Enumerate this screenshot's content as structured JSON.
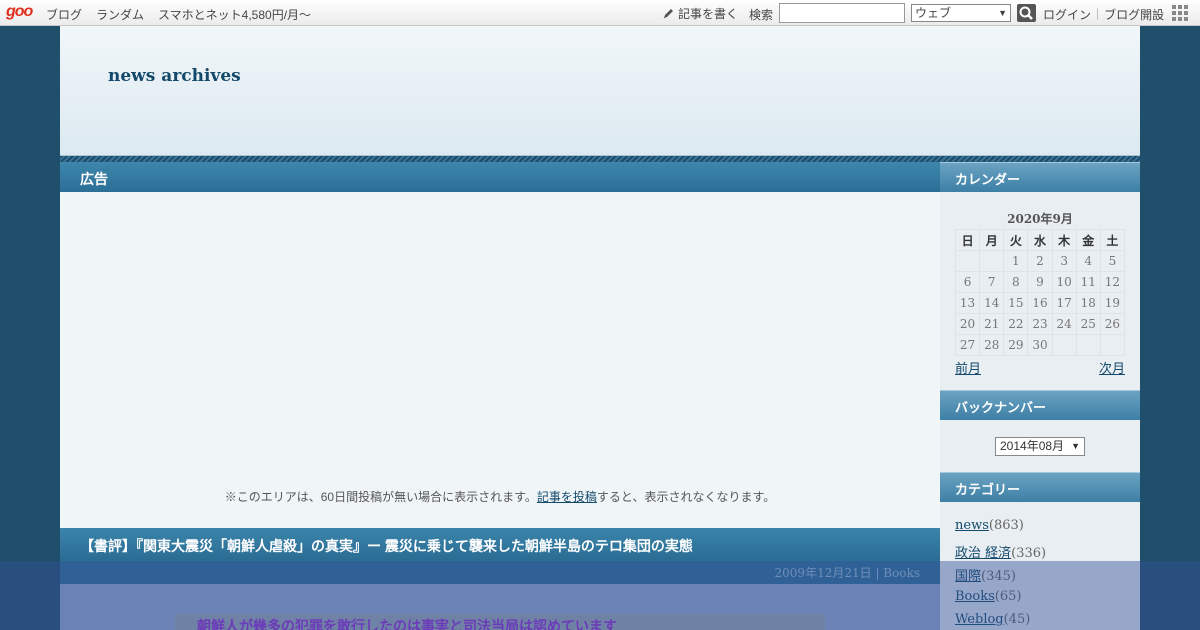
{
  "topbar": {
    "logo": "goo",
    "nav": [
      "ブログ",
      "ランダム",
      "スマホとネット4,580円/月～"
    ],
    "write": "記事を書く",
    "search_label": "検索",
    "search_value": "",
    "select_value": "ウェブ",
    "login": "ログイン",
    "signup": "ブログ開設"
  },
  "header": {
    "title": "news archives"
  },
  "ad": {
    "heading": "広告",
    "note_before": "※このエリアは、60日間投稿が無い場合に表示されます。",
    "note_link": "記事を投稿",
    "note_after": "すると、表示されなくなります。"
  },
  "post": {
    "title": "【書評】『関東大震災「朝鮮人虐殺」の真実』ー 震災に乗じて襲来した朝鮮半島のテロ集団の実態",
    "date": "2009年12月21日",
    "category": "Books",
    "image_caption": "朝鮮人が幾多の犯罪を敢行したのは事実と司法当局は認めています"
  },
  "sidebar": {
    "calendar_heading": "カレンダー",
    "calendar_month": "2020年9月",
    "weekdays": [
      "日",
      "月",
      "火",
      "水",
      "木",
      "金",
      "土"
    ],
    "weeks": [
      [
        "",
        "",
        "1",
        "2",
        "3",
        "4",
        "5"
      ],
      [
        "6",
        "7",
        "8",
        "9",
        "10",
        "11",
        "12"
      ],
      [
        "13",
        "14",
        "15",
        "16",
        "17",
        "18",
        "19"
      ],
      [
        "20",
        "21",
        "22",
        "23",
        "24",
        "25",
        "26"
      ],
      [
        "27",
        "28",
        "29",
        "30",
        "",
        "",
        ""
      ]
    ],
    "prev": "前月",
    "next": "次月",
    "backnumber_heading": "バックナンバー",
    "backnumber_value": "2014年08月",
    "category_heading": "カテゴリー",
    "categories": [
      {
        "name": "news",
        "count": "(863)"
      },
      {
        "name": "政治 経済",
        "count": "(336)"
      },
      {
        "name": "国際",
        "count": "(345)"
      },
      {
        "name": "Books",
        "count": "(65)"
      },
      {
        "name": "Weblog",
        "count": "(45)"
      }
    ]
  }
}
